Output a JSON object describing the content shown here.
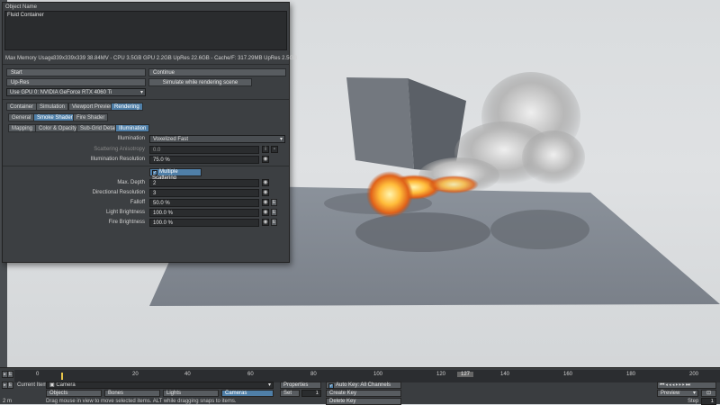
{
  "panel": {
    "object_name_label": "Object Name",
    "object_name_value": "Fluid Container",
    "memory_label": "Max Memory Usage",
    "memory_value": "339x339x339 38.84MV - CPU 3.5GB GPU 2.2GB UpRes 22.6GB - Cache/F: 317.29MB UpRes 2.5GB",
    "start": "Start",
    "continue": "Continue",
    "upres": "Up-Res",
    "simulate_rendering": "Simulate while rendering scene",
    "gpu": "Use GPU 0: NVIDIA GeForce RTX 4060 Ti",
    "tabs1": [
      "Container",
      "Simulation",
      "Viewport Preview",
      "Rendering"
    ],
    "tabs2": [
      "General",
      "Smoke Shader",
      "Fire Shader"
    ],
    "tabs3": [
      "Mapping",
      "Color & Opacity",
      "Sub-Grid Detail",
      "Illumination"
    ],
    "illumination_label": "Illumination",
    "illumination_value": "Voxelized Fast",
    "scattering_label": "Scattering Anisotropy",
    "scattering_value": "0.0",
    "illum_res_label": "Illumination Resolution",
    "illum_res_value": "75.0 %",
    "multiple_scattering": "Multiple Scattering",
    "max_depth_label": "Max. Depth",
    "max_depth_value": "2",
    "dir_res_label": "Directional Resolution",
    "dir_res_value": "3",
    "falloff_label": "Falloff",
    "falloff_value": "50.0 %",
    "light_bright_label": "Light Brightness",
    "light_bright_value": "100.0 %",
    "fire_bright_label": "Fire Brightness",
    "fire_bright_value": "100.0 %",
    "e": "E"
  },
  "timeline": {
    "ticks": [
      "0",
      "20",
      "40",
      "60",
      "80",
      "100",
      "120",
      "127",
      "140",
      "160",
      "180",
      "200"
    ],
    "current_item_label": "Current Item",
    "current_item_value": "Camera",
    "properties": "Properties",
    "auto_key": "Auto Key: All Channels",
    "objects": "Objects",
    "bones": "Bones",
    "lights": "Lights",
    "cameras": "Cameras",
    "set": "Set",
    "set_value": "1",
    "create_key": "Create Key",
    "delete_key": "Delete Key",
    "preview": "Preview",
    "step": "Step",
    "step_value": "1",
    "status": "Drag mouse in view to move selected items. ALT while dragging snaps to items.",
    "grid": "2 m",
    "e": "E"
  },
  "colors": {
    "accent": "#4f7fa8",
    "panel": "#3c3f42"
  }
}
